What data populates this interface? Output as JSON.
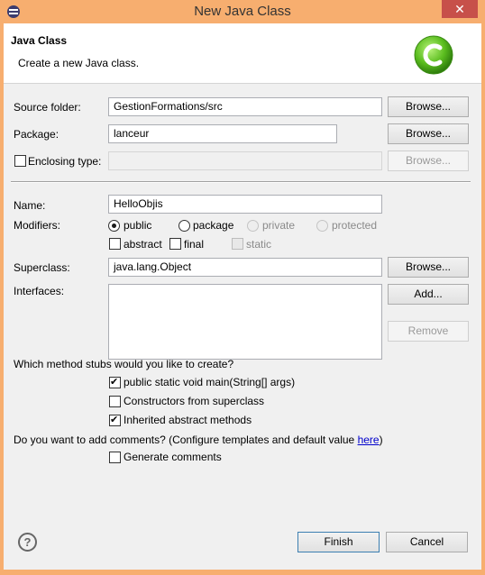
{
  "window": {
    "title": "New Java Class",
    "close_label": "✕"
  },
  "header": {
    "title": "Java Class",
    "description": "Create a new Java class."
  },
  "source_folder": {
    "label": "Source folder:",
    "value": "GestionFormations/src",
    "browse": "Browse..."
  },
  "package": {
    "label": "Package:",
    "value": "lanceur",
    "browse": "Browse..."
  },
  "enclosing_type": {
    "label": "Enclosing type:",
    "value": "",
    "browse": "Browse...",
    "checked": false
  },
  "name": {
    "label": "Name:",
    "value": "HelloObjis"
  },
  "modifiers": {
    "label": "Modifiers:",
    "access": [
      "public",
      "package",
      "private",
      "protected"
    ],
    "selected": "public",
    "abstract": "abstract",
    "final": "final",
    "static": "static"
  },
  "superclass": {
    "label": "Superclass:",
    "value": "java.lang.Object",
    "browse": "Browse..."
  },
  "interfaces": {
    "label": "Interfaces:",
    "add": "Add...",
    "remove": "Remove"
  },
  "stubs": {
    "question": "Which method stubs would you like to create?",
    "main": "public static void main(String[] args)",
    "constructors": "Constructors from superclass",
    "inherited": "Inherited abstract methods"
  },
  "comments": {
    "question": "Do you want to add comments? (Configure templates and default value ",
    "link": "here",
    "close_paren": ")",
    "generate": "Generate comments"
  },
  "footer": {
    "help": "?",
    "finish": "Finish",
    "cancel": "Cancel"
  },
  "colors": {
    "title_bar": "#f7ae6f",
    "logo": "#5bbd1f"
  }
}
